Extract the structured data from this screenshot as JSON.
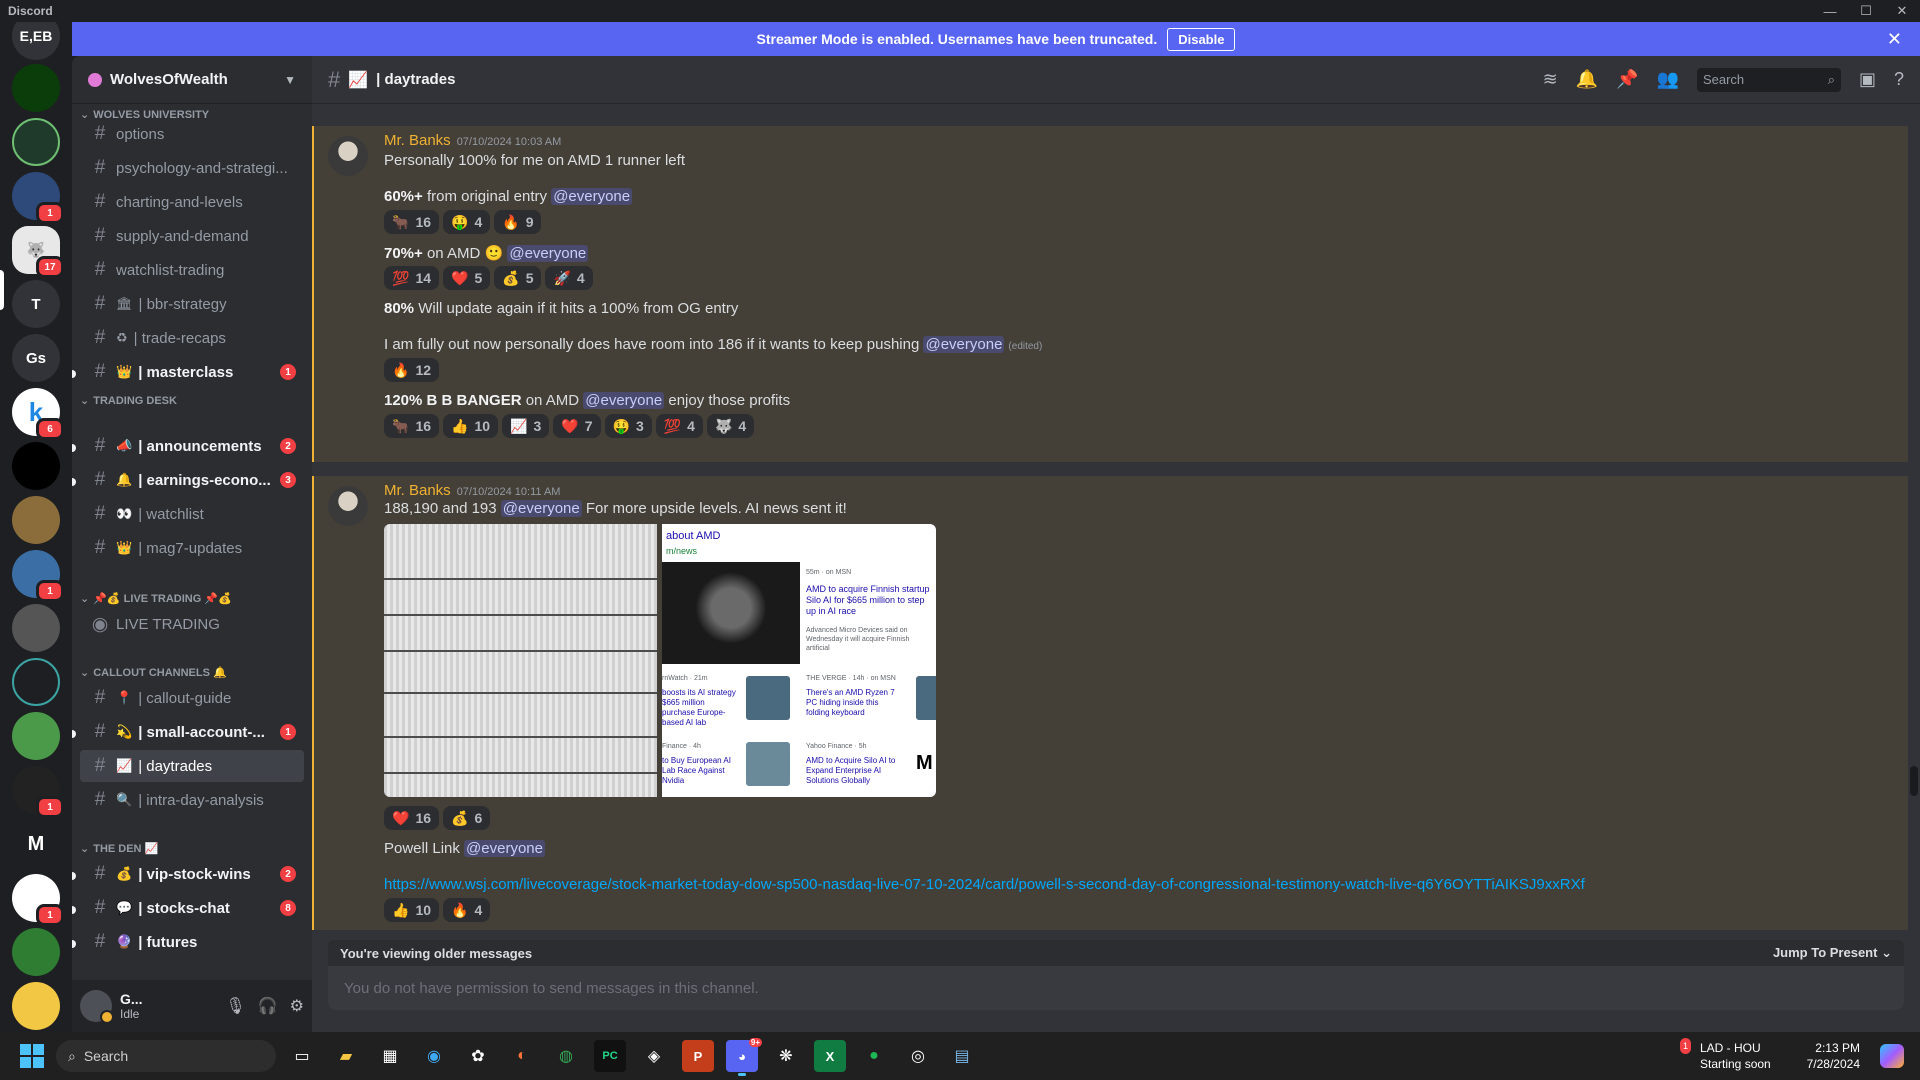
{
  "window": {
    "app_name": "Discord"
  },
  "banner": {
    "text": "Streamer Mode is enabled. Usernames have been truncated.",
    "button": "Disable"
  },
  "rail": {
    "servers": [
      {
        "label": "E,EB",
        "badge": ""
      },
      {
        "label": "",
        "badge": ""
      },
      {
        "label": "",
        "badge": ""
      },
      {
        "label": "",
        "badge": "1"
      },
      {
        "label": "",
        "badge": "17"
      },
      {
        "label": "T",
        "badge": ""
      },
      {
        "label": "Gs",
        "badge": ""
      },
      {
        "label": "k",
        "badge": "6"
      },
      {
        "label": "",
        "badge": ""
      },
      {
        "label": "",
        "badge": ""
      },
      {
        "label": "",
        "badge": "1"
      },
      {
        "label": "",
        "badge": ""
      },
      {
        "label": "",
        "badge": ""
      },
      {
        "label": "",
        "badge": ""
      },
      {
        "label": "",
        "badge": "1"
      },
      {
        "label": "M",
        "badge": ""
      },
      {
        "label": "",
        "badge": "1"
      },
      {
        "label": "",
        "badge": ""
      }
    ]
  },
  "guild": {
    "name": "WolvesOfWealth"
  },
  "categories": {
    "wolves_university": "WOLVES UNIVERSITY",
    "trading_desk": "TRADING DESK",
    "live_trading": "📌💰 LIVE TRADING 📌💰",
    "callout_channels": "CALLOUT CHANNELS 🔔",
    "the_den": "THE DEN 📈"
  },
  "channels": {
    "options": "options",
    "psychology": "psychology-and-strategi...",
    "charting": "charting-and-levels",
    "supply": "supply-and-demand",
    "watchlist_trading": "watchlist-trading",
    "bbr": "| bbr-strategy",
    "trade_recaps": "| trade-recaps",
    "masterclass": "| masterclass",
    "masterclass_badge": "1",
    "announcements": "| announcements",
    "announcements_badge": "2",
    "earnings": "| earnings-econo...",
    "earnings_badge": "3",
    "watchlist": "| watchlist",
    "mag7": "| mag7-updates",
    "live_trading": "LIVE TRADING",
    "callout_guide": "| callout-guide",
    "small_account": "| small-account-...",
    "small_account_badge": "1",
    "daytrades": "| daytrades",
    "intra_day": "| intra-day-analysis",
    "vip_stock": "| vip-stock-wins",
    "vip_stock_badge": "2",
    "stocks_chat": "| stocks-chat",
    "stocks_chat_badge": "8",
    "futures": "| futures"
  },
  "user": {
    "name": "G...",
    "status": "Idle"
  },
  "header": {
    "channel_title": "| daytrades",
    "search_placeholder": "Search"
  },
  "messages": {
    "m1": {
      "author": "Mr. Banks",
      "timestamp": "07/10/2024 10:03 AM",
      "l1": "Personally 100% for me on AMD 1 runner left",
      "l2_bold": "60%+",
      "l2_text": " from original entry ",
      "mention": "@everyone",
      "r1": [
        {
          "emoji": "🐂",
          "count": "16"
        },
        {
          "emoji": "🤑",
          "count": "4"
        },
        {
          "emoji": "🔥",
          "count": "9"
        }
      ],
      "l3_bold": "70%+",
      "l3_text": " on AMD 🙂 ",
      "r2": [
        {
          "emoji": "💯",
          "count": "14"
        },
        {
          "emoji": "❤️",
          "count": "5"
        },
        {
          "emoji": "💰",
          "count": "5"
        },
        {
          "emoji": "🚀",
          "count": "4"
        }
      ],
      "l4_bold": "80%",
      "l4_text": " Will update again if it hits a 100% from OG entry",
      "l5_text": "I am fully out now personally does have room into 186 if it wants to keep pushing ",
      "edited": "(edited)",
      "r3": [
        {
          "emoji": "🔥",
          "count": "12"
        }
      ],
      "l6_bold": "120% B B BANGER",
      "l6_text": " on AMD ",
      "l6_tail": " enjoy those profits",
      "r4": [
        {
          "emoji": "🐂",
          "count": "16"
        },
        {
          "emoji": "👍",
          "count": "10"
        },
        {
          "emoji": "📈",
          "count": "3"
        },
        {
          "emoji": "❤️",
          "count": "7"
        },
        {
          "emoji": "🤑",
          "count": "3"
        },
        {
          "emoji": "💯",
          "count": "4"
        },
        {
          "emoji": "🐺",
          "count": "4"
        }
      ]
    },
    "m2": {
      "author": "Mr. Banks",
      "timestamp": "07/10/2024 10:11 AM",
      "l1_text": "188,190 and 193 ",
      "l1_tail": " For more upside levels. AI news sent it!",
      "news": {
        "heading": "about AMD",
        "source": "m/news",
        "n1_src": "55m · on MSN",
        "n1_title": "AMD to acquire Finnish startup Silo AI for $665 million to step up in AI race",
        "n1_desc": "Advanced Micro Devices said on Wednesday it will acquire Finnish artificial",
        "n2_src": "rnWatch · 21m",
        "n2_title": "boosts its AI strategy $665 million purchase Europe-based AI lab",
        "n3_src": "THE VERGE · 14h · on MSN",
        "n3_title": "There's an AMD Ryzen 7 PC hiding inside this folding keyboard",
        "n4_src": "Finance · 4h",
        "n4_title": "to Buy European AI Lab Race Against Nvidia",
        "n5_src": "Yahoo Finance · 5h",
        "n5_title": "AMD to Acquire Silo AI to Expand Enterprise AI Solutions Globally"
      },
      "r1": [
        {
          "emoji": "❤️",
          "count": "16"
        },
        {
          "emoji": "💰",
          "count": "6"
        }
      ],
      "l2_text": "Powell Link ",
      "link": "https://www.wsj.com/livecoverage/stock-market-today-dow-sp500-nasdaq-live-07-10-2024/card/powell-s-second-day-of-congressional-testimony-watch-live-q6Y6OYTTiAIKSJ9xxRXf",
      "r2": [
        {
          "emoji": "👍",
          "count": "10"
        },
        {
          "emoji": "🔥",
          "count": "4"
        }
      ]
    }
  },
  "older": {
    "text": "You're viewing older messages",
    "jump": "Jump To Present"
  },
  "composer": {
    "placeholder": "You do not have permission to send messages in this channel."
  },
  "taskbar": {
    "search": "Search",
    "discord_badge": "9+",
    "game_badge": "1",
    "game_title": "LAD - HOU",
    "game_status": "Starting soon",
    "time": "2:13 PM",
    "date": "7/28/2024"
  }
}
